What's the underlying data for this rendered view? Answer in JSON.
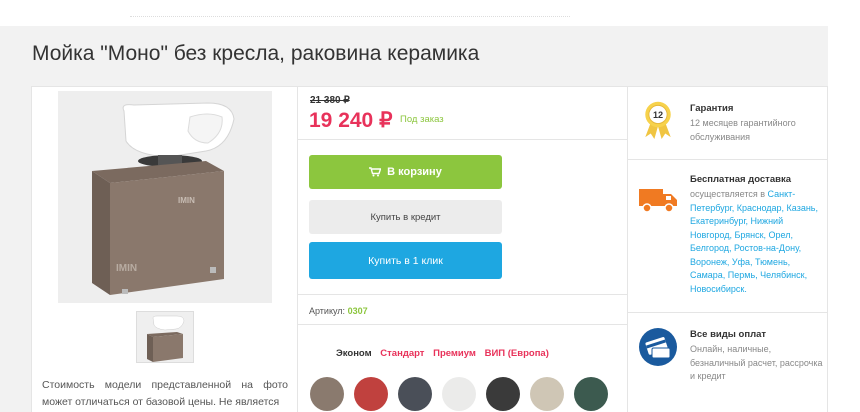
{
  "product": {
    "title": "Мойка \"Моно\" без кресла, раковина керамика",
    "old_price": "21 380 ₽",
    "price": "19 240 ₽",
    "availability": "Под заказ",
    "article_label": "Артикул:",
    "article_value": "0307",
    "image_note": "Стоимость модели представленной на фото может отличаться от базовой цены. Не является",
    "brand_watermark": "IMIN"
  },
  "buttons": {
    "cart": "В корзину",
    "credit": "Купить в кредит",
    "one_click": "Купить в 1 клик"
  },
  "tabs": [
    {
      "label": "Эконом",
      "active": true
    },
    {
      "label": "Стандарт",
      "active": false
    },
    {
      "label": "Премиум",
      "active": false
    },
    {
      "label": "ВИП (Европа)",
      "active": false
    }
  ],
  "swatches": [
    "#8a7a6e",
    "#c0413e",
    "#4a4f58",
    "#ebebea",
    "#3a3a3a",
    "#cfc6b5",
    "#3c5a4f"
  ],
  "info": {
    "guarantee": {
      "heading": "Гарантия",
      "text": "12 месяцев гарантийного обслуживания",
      "badge": "12"
    },
    "delivery": {
      "heading": "Бесплатная доставка",
      "text_prefix": "осуществляется в ",
      "cities": "Санкт-Петербург, Краснодар, Казань, Екатеринбург, Нижний Новгород, Брянск, Орел, Белгород, Ростов-на-Дону, Воронеж, Уфа, Тюмень, Самара, Пермь, Челябинск, Новосибирск."
    },
    "payment": {
      "heading": "Все виды оплат",
      "text": "Онлайн, наличные, безналичный расчет, рассрочка и кредит"
    }
  },
  "colors": {
    "accent_green": "#8cc63e",
    "price_pink": "#e8325a",
    "button_blue": "#1ea7e1",
    "delivery_orange": "#f07a22",
    "payment_blue": "#1a5a9e"
  }
}
